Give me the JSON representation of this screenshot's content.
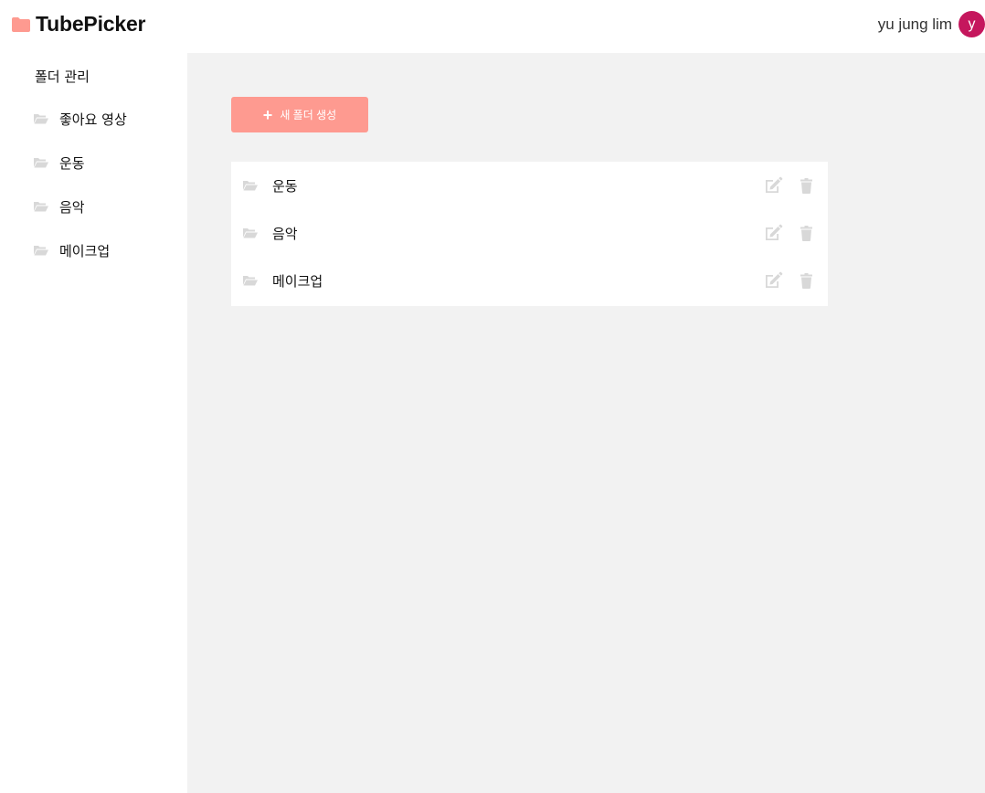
{
  "app": {
    "title": "TubePicker"
  },
  "user": {
    "name": "yu jung lim",
    "initial": "y"
  },
  "sidebar": {
    "heading": "폴더 관리",
    "items": [
      {
        "label": "좋아요 영상",
        "icon": "folder-open-icon"
      },
      {
        "label": "운동",
        "icon": "folder-open-icon"
      },
      {
        "label": "음악",
        "icon": "folder-open-icon"
      },
      {
        "label": "메이크업",
        "icon": "folder-open-icon"
      }
    ]
  },
  "main": {
    "new_folder_button": {
      "label": "새 폴더 생성",
      "icon": "plus-icon"
    },
    "folders": [
      {
        "name": "운동",
        "icon": "folder-open-icon"
      },
      {
        "name": "음악",
        "icon": "folder-open-icon"
      },
      {
        "name": "메이크업",
        "icon": "folder-open-icon"
      }
    ]
  },
  "colors": {
    "brand_accent": "#fe9a90",
    "avatar_bg": "#c5175d",
    "main_bg": "#f2f2f2",
    "icon_gray": "#d8d8d8"
  }
}
